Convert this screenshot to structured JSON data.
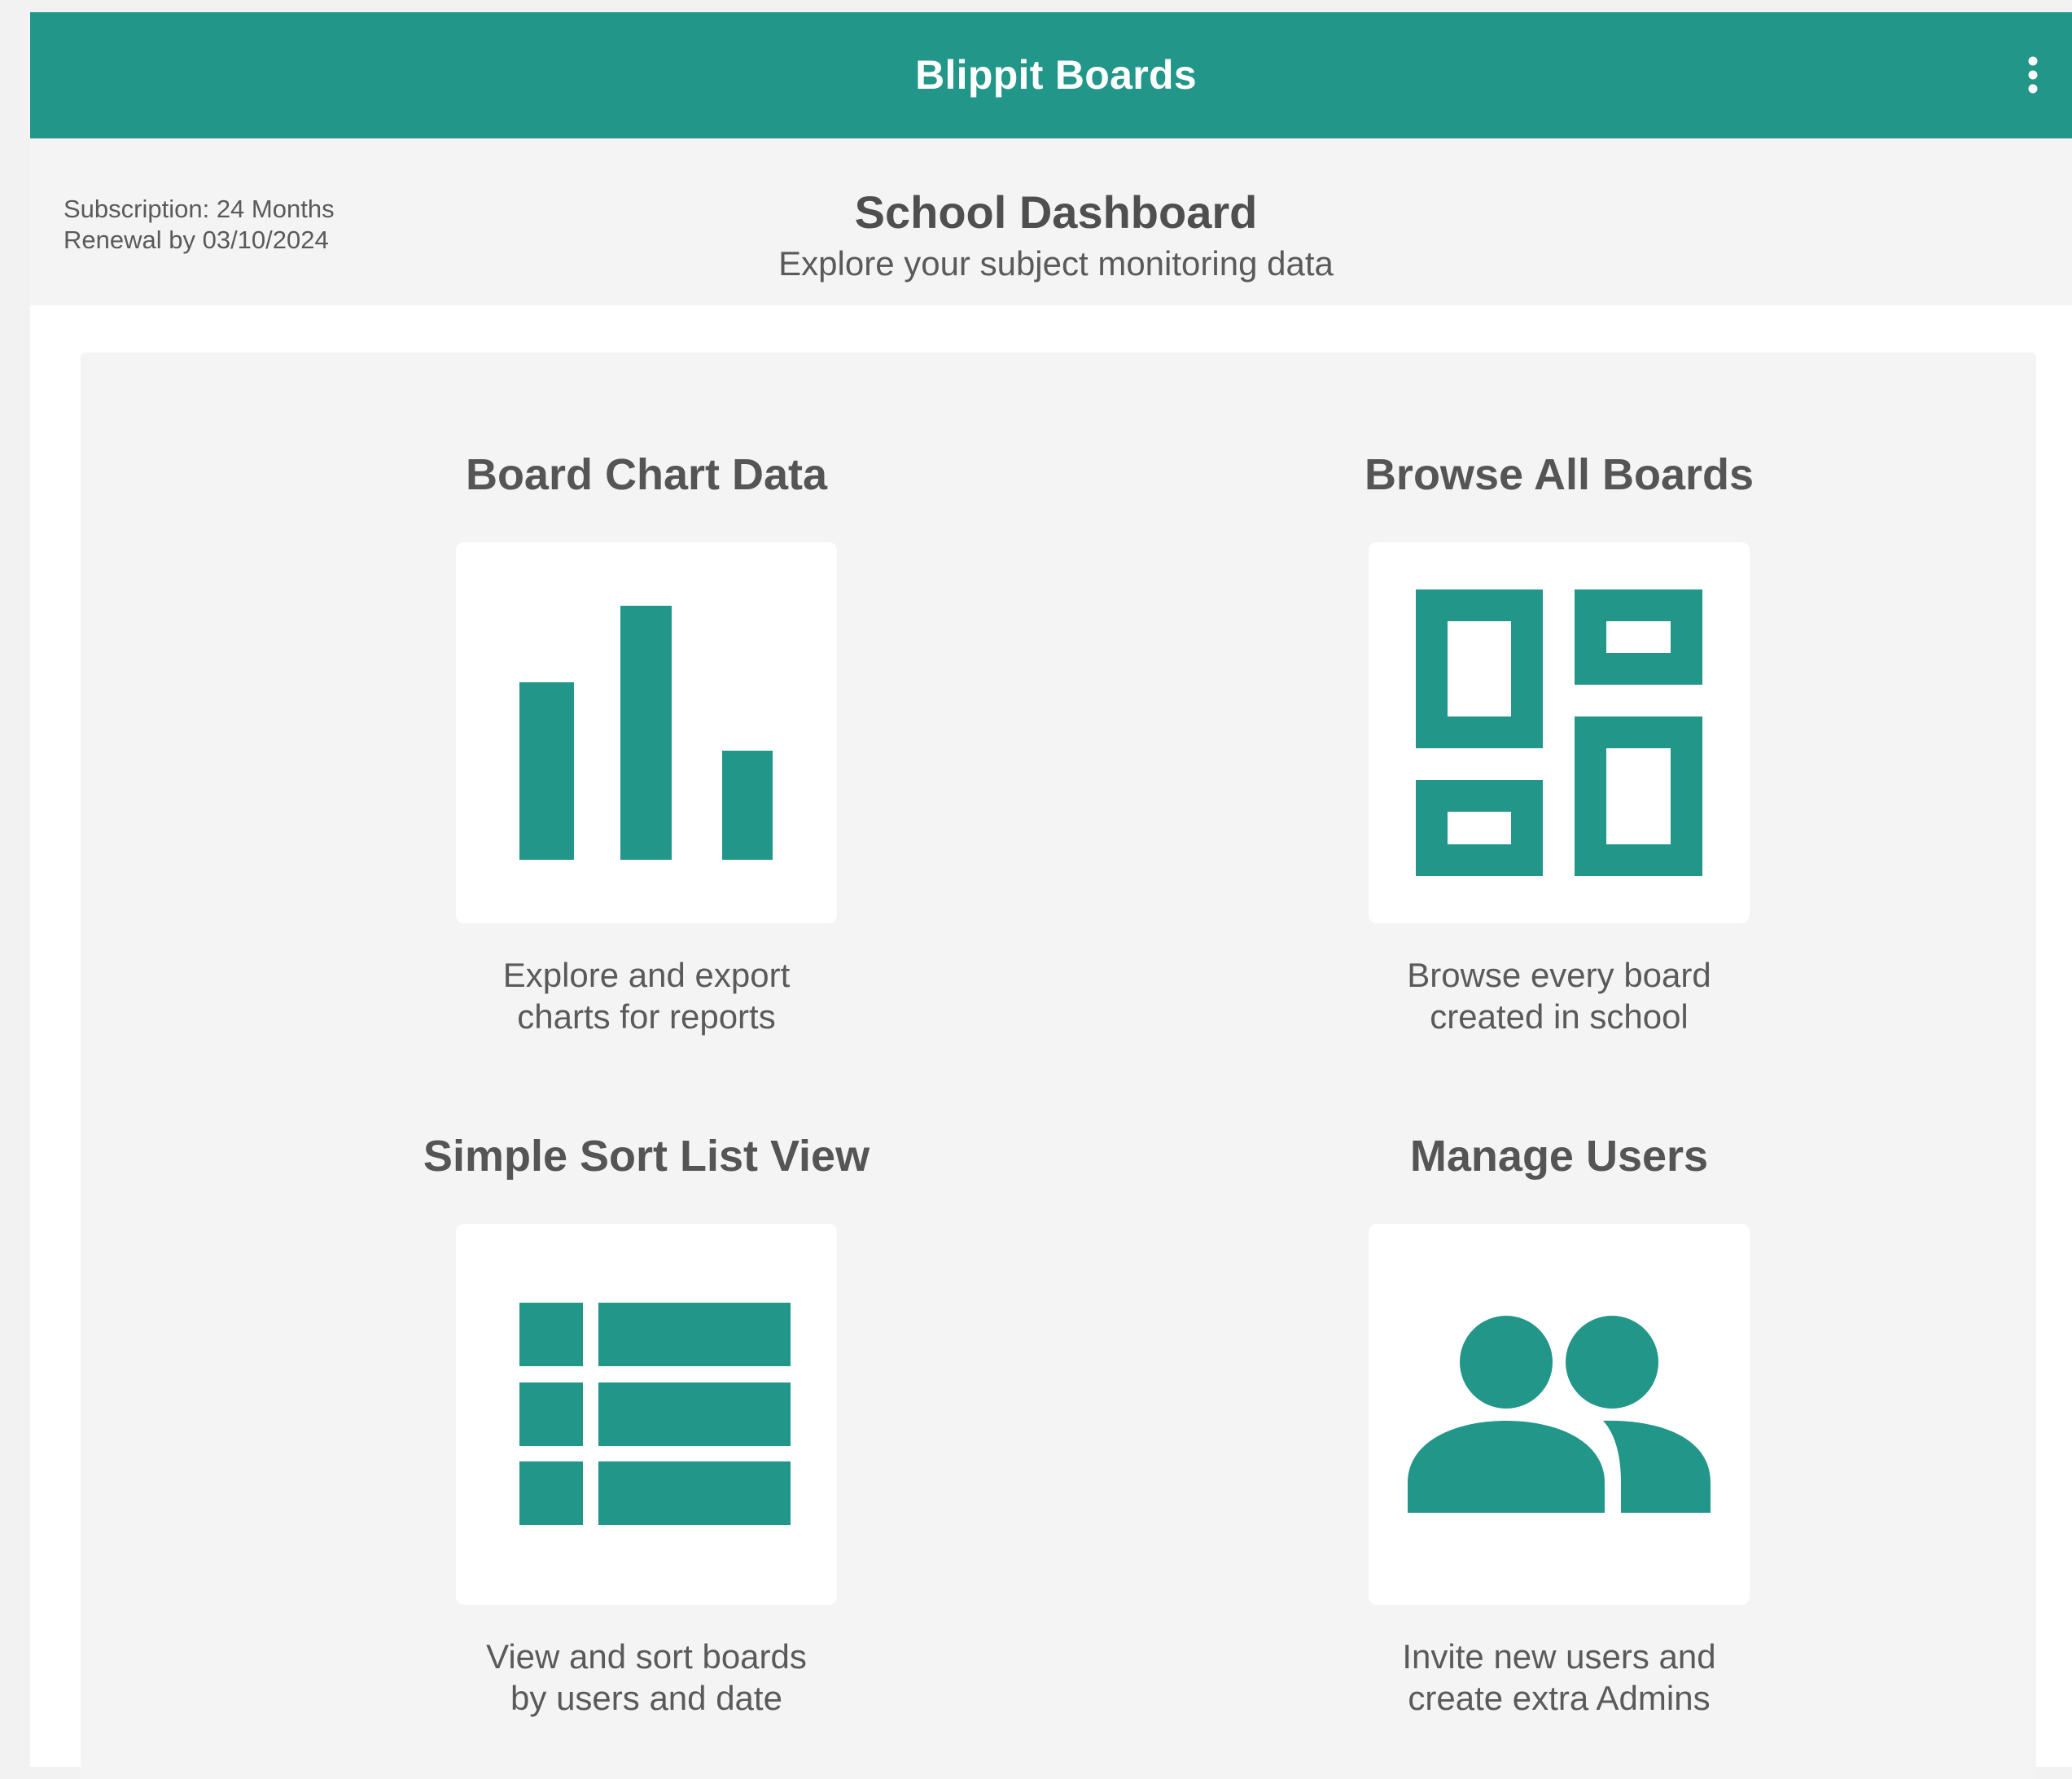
{
  "app": {
    "title": "Blippit Boards",
    "menu_icon": "more-vert-icon",
    "accent_color": "#229688"
  },
  "header": {
    "subscription": "Subscription: 24 Months",
    "renewal": "Renewal by 03/10/2024",
    "title": "School Dashboard",
    "subtitle": "Explore your subject monitoring data"
  },
  "cards": [
    {
      "title": "Board Chart Data",
      "desc_line1": "Explore and export",
      "desc_line2": "charts for reports",
      "icon": "bar-chart-icon"
    },
    {
      "title": "Browse All Boards",
      "desc_line1": "Browse every board",
      "desc_line2": "created in school",
      "icon": "dashboard-grid-icon"
    },
    {
      "title": "Simple Sort List View",
      "desc_line1": "View and sort boards",
      "desc_line2": "by users and date",
      "icon": "list-view-icon"
    },
    {
      "title": "Manage Users",
      "desc_line1": "Invite new users and",
      "desc_line2": "create extra Admins",
      "icon": "people-icon"
    }
  ]
}
